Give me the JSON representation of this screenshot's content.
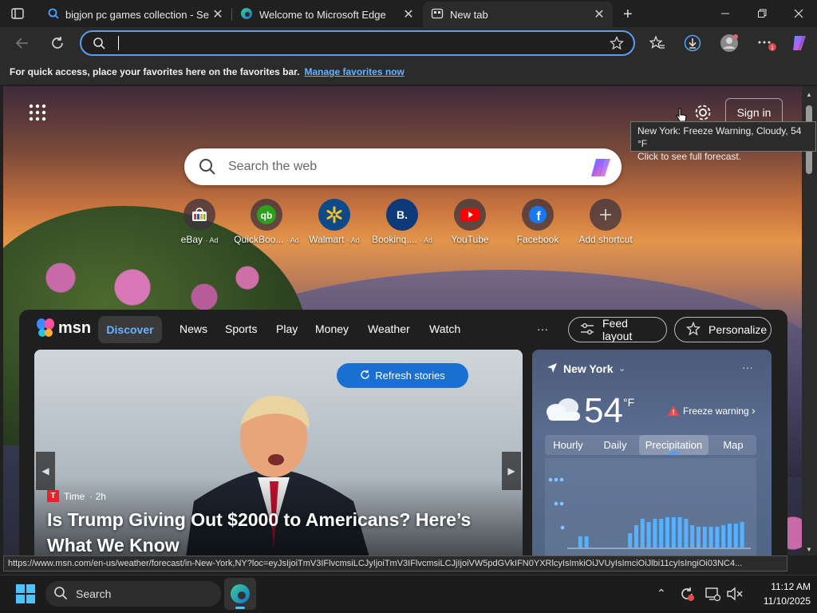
{
  "tabs": [
    {
      "title": "bigjon pc games collection - Search",
      "icon": "search-tab-icon"
    },
    {
      "title": "Welcome to Microsoft Edge",
      "icon": "edge-icon"
    },
    {
      "title": "New tab",
      "icon": "newtab-icon"
    }
  ],
  "address": {
    "value": "",
    "placeholder": ""
  },
  "favbar": {
    "text": "For quick access, place your favorites here on the favorites bar.",
    "link": "Manage favorites now"
  },
  "ntp": {
    "signin": "Sign in",
    "tooltip_line1": "New York: Freeze Warning, Cloudy, 54 °F",
    "tooltip_line2": "Click to see full forecast.",
    "search_placeholder": "Search the web",
    "quicklinks": [
      {
        "label": "eBay",
        "ad": "· Ad"
      },
      {
        "label": "QuickBoo...",
        "ad": "· Ad"
      },
      {
        "label": "Walmart",
        "ad": "· Ad"
      },
      {
        "label": "Bookinq....",
        "ad": "· Ad"
      },
      {
        "label": "YouTube",
        "ad": ""
      },
      {
        "label": "Facebook",
        "ad": ""
      },
      {
        "label": "Add shortcut",
        "ad": ""
      }
    ]
  },
  "msn": {
    "logo": "msn",
    "nav": [
      "Discover",
      "News",
      "Sports",
      "Play",
      "Money",
      "Weather",
      "Watch"
    ],
    "more": "···",
    "feed_layout": "Feed layout",
    "personalize": "Personalize"
  },
  "hero": {
    "refresh": "Refresh stories",
    "source": "Time",
    "age": "· 2h",
    "title": "Is Trump Giving Out $2000 to Americans? Here’s What We Know"
  },
  "weather": {
    "location": "New York",
    "temp": "54",
    "unit": "°F",
    "alert": "Freeze warning",
    "tabs": [
      "Hourly",
      "Daily",
      "Precipitation",
      "Map"
    ],
    "more": "···"
  },
  "status_url": "https://www.msn.com/en-us/weather/forecast/in-New-York,NY?loc=eyJsIjoiTmV3IFlvcmsiLCJyIjoiTmV3IFlvcmsiLCJjIjoiVW5pdGVkIFN0YXRlcyIsImkiOiJVUyIsImciOiJlbi11cyIsIngiOi03NC4...",
  "taskbar": {
    "search": "Search",
    "time": "11:12 AM",
    "date": "11/10/2025"
  }
}
